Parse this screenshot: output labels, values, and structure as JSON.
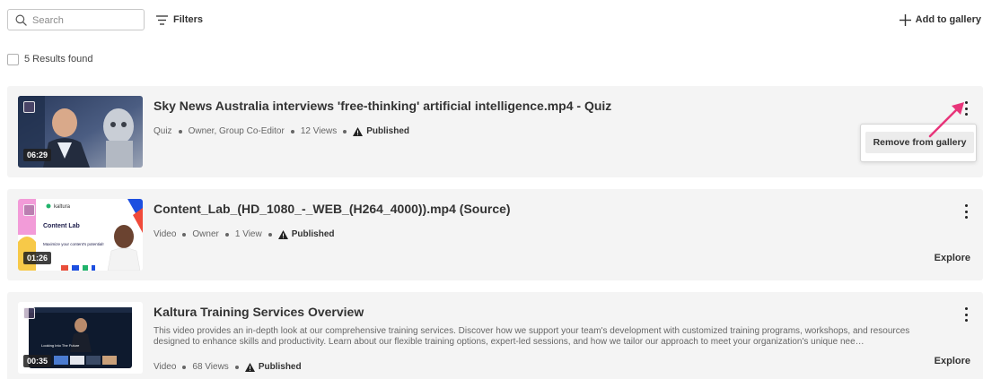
{
  "toolbar": {
    "search_placeholder": "Search",
    "filters_label": "Filters",
    "add_to_gallery_label": "Add to gallery"
  },
  "results": {
    "label": "5 Results found"
  },
  "entries": [
    {
      "title": "Sky News Australia interviews 'free-thinking' artificial intelligence.mp4 - Quiz",
      "type": "Quiz",
      "role": "Owner, Group Co-Editor",
      "views": "12 Views",
      "status": "Published",
      "duration": "06:29"
    },
    {
      "title": "Content_Lab_(HD_1080_-_WEB_(H264_4000)).mp4 (Source)",
      "type": "Video",
      "role": "Owner",
      "views": "1 View",
      "status": "Published",
      "duration": "01:26",
      "action": "Explore",
      "thumb_text": {
        "brand": "kaltura",
        "heading": "Content Lab",
        "sub": "Maximize your content's potential!"
      }
    },
    {
      "title": "Kaltura Training Services Overview",
      "description": "This video provides an in-depth look at our comprehensive training services. Discover how we support your team's development with customized training programs, workshops, and resources designed to enhance skills and productivity. Learn about our flexible training options, expert-led sessions, and how we tailor our approach to meet your organization's unique nee…",
      "type": "Video",
      "views": "68 Views",
      "status": "Published",
      "duration": "00:35",
      "action": "Explore",
      "thumb_text": {
        "heading": "Looking Into The Future"
      }
    }
  ],
  "context_menu": {
    "item_label": "Remove from gallery"
  },
  "colors": {
    "annotation_arrow": "#e8357a",
    "card_background": "#f4f4f4"
  }
}
